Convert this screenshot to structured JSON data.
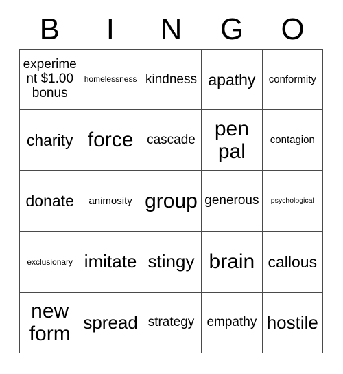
{
  "header": {
    "letters": [
      "B",
      "I",
      "N",
      "G",
      "O"
    ]
  },
  "grid": {
    "rows": 5,
    "columns": 5,
    "border_color": "#4a4a4a",
    "background_color": "#ffffff",
    "text_color": "#000000",
    "cells": [
      [
        {
          "text": "experiment $1.00 bonus",
          "size": "fs-md"
        },
        {
          "text": "homelessness",
          "size": "fs-xs"
        },
        {
          "text": "kindness",
          "size": "fs-md"
        },
        {
          "text": "apathy",
          "size": "fs-lg"
        },
        {
          "text": "conformity",
          "size": "fs-sm"
        }
      ],
      [
        {
          "text": "charity",
          "size": "fs-lg"
        },
        {
          "text": "force",
          "size": "fs-xxl"
        },
        {
          "text": "cascade",
          "size": "fs-md"
        },
        {
          "text": "pen pal",
          "size": "fs-xxl"
        },
        {
          "text": "contagion",
          "size": "fs-sm"
        }
      ],
      [
        {
          "text": "donate",
          "size": "fs-lg"
        },
        {
          "text": "animosity",
          "size": "fs-sm"
        },
        {
          "text": "group",
          "size": "fs-xxl"
        },
        {
          "text": "generous",
          "size": "fs-md"
        },
        {
          "text": "psychological",
          "size": "fs-xxs"
        }
      ],
      [
        {
          "text": "exclusionary",
          "size": "fs-xs"
        },
        {
          "text": "imitate",
          "size": "fs-xl"
        },
        {
          "text": "stingy",
          "size": "fs-xl"
        },
        {
          "text": "brain",
          "size": "fs-xxl"
        },
        {
          "text": "callous",
          "size": "fs-lg"
        }
      ],
      [
        {
          "text": "new form",
          "size": "fs-xxl"
        },
        {
          "text": "spread",
          "size": "fs-xl"
        },
        {
          "text": "strategy",
          "size": "fs-md"
        },
        {
          "text": "empathy",
          "size": "fs-md"
        },
        {
          "text": "hostile",
          "size": "fs-xl"
        }
      ]
    ]
  }
}
